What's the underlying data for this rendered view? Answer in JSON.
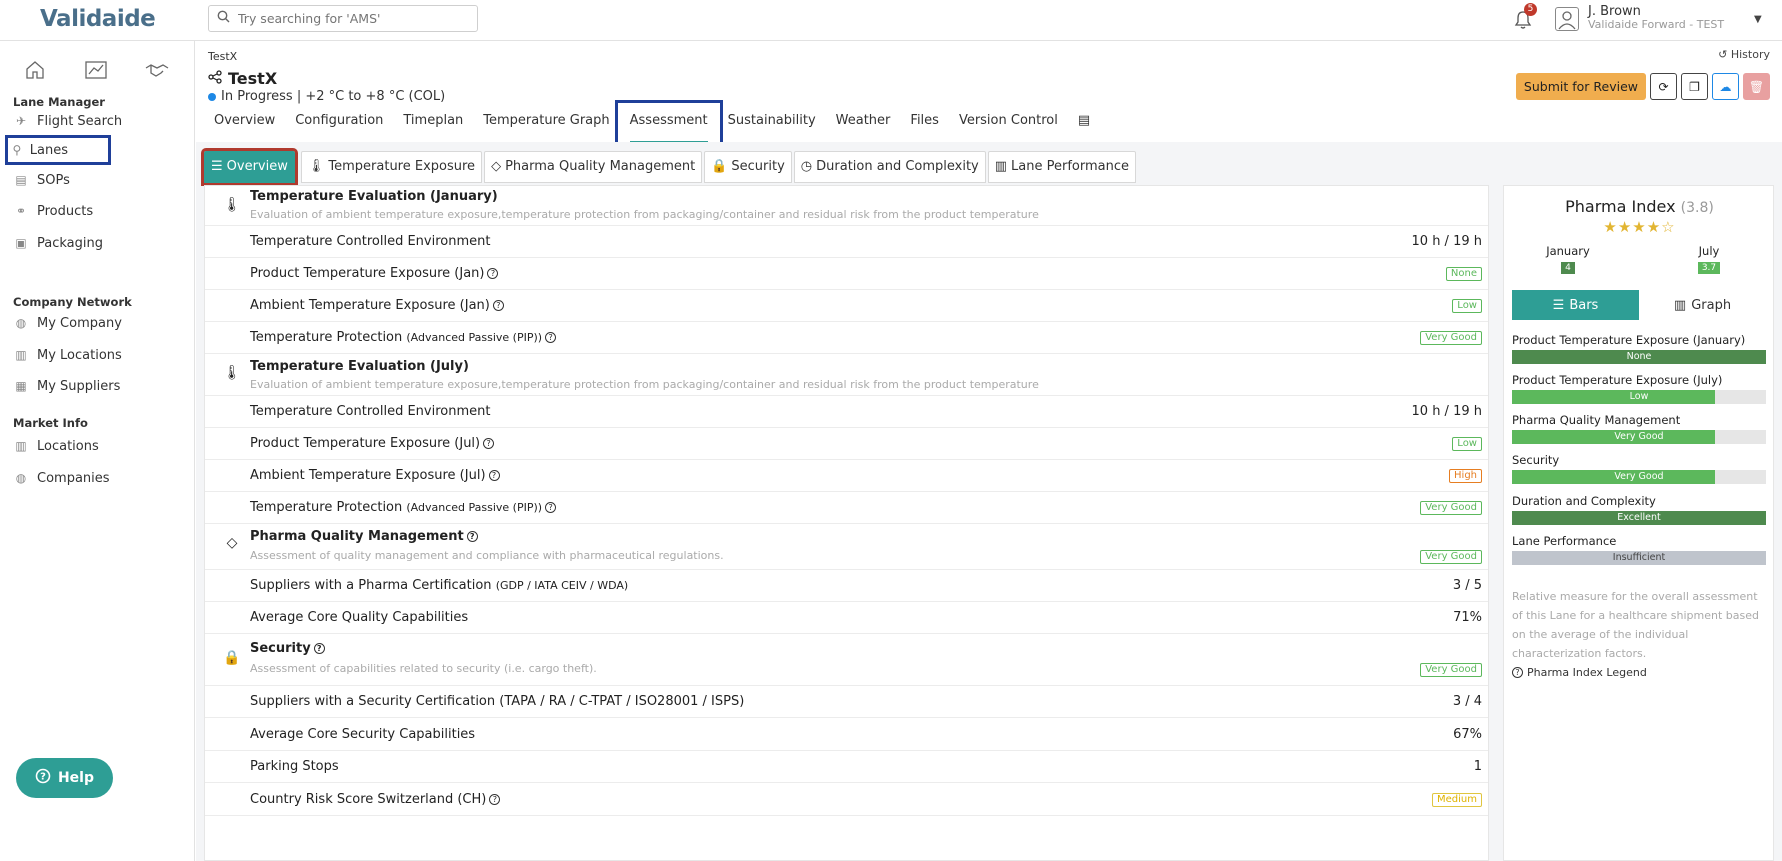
{
  "app": {
    "logo": "Validaide"
  },
  "search": {
    "placeholder": "Try searching for 'AMS'"
  },
  "notifications": {
    "count": "5"
  },
  "user": {
    "name": "J. Brown",
    "org": "Validaide Forward - TEST"
  },
  "sidebar": {
    "sections": [
      {
        "title": "Lane Manager",
        "items": [
          "Flight Search",
          "Lanes",
          "SOPs",
          "Products",
          "Packaging"
        ]
      },
      {
        "title": "Company Network",
        "items": [
          "My Company",
          "My Locations",
          "My Suppliers"
        ]
      },
      {
        "title": "Market Info",
        "items": [
          "Locations",
          "Companies"
        ]
      }
    ],
    "help": "Help"
  },
  "lane": {
    "breadcrumb": "TestX",
    "title": "TestX",
    "status": "In Progress | +2 °C to +8 °C (COL)",
    "history": "History",
    "submit": "Submit for Review"
  },
  "tabs": [
    "Overview",
    "Configuration",
    "Timeplan",
    "Temperature Graph",
    "Assessment",
    "Sustainability",
    "Weather",
    "Files",
    "Version Control"
  ],
  "subtabs": [
    "Overview",
    "Temperature Exposure",
    "Pharma Quality Management",
    "Security",
    "Duration and Complexity",
    "Lane Performance"
  ],
  "rows": {
    "jan_title": "Temperature Evaluation (January)",
    "jan_desc": "Evaluation of ambient temperature exposure,temperature protection from packaging/container and residual risk from the product temperature",
    "jan_tce": "Temperature Controlled Environment",
    "jan_tce_val": "10 h / 19 h",
    "jan_pte": "Product Temperature Exposure (Jan)",
    "jan_pte_val": "None",
    "jan_ate": "Ambient Temperature Exposure (Jan)",
    "jan_ate_val": "Low",
    "jan_tp": "Temperature Protection",
    "jan_tp_small": "(Advanced Passive (PIP))",
    "jan_tp_val": "Very Good",
    "jul_title": "Temperature Evaluation (July)",
    "jul_desc": "Evaluation of ambient temperature exposure,temperature protection from packaging/container and residual risk from the product temperature",
    "jul_tce": "Temperature Controlled Environment",
    "jul_tce_val": "10 h / 19 h",
    "jul_pte": "Product Temperature Exposure (Jul)",
    "jul_pte_val": "Low",
    "jul_ate": "Ambient Temperature Exposure (Jul)",
    "jul_ate_val": "High",
    "jul_tp": "Temperature Protection",
    "jul_tp_small": "(Advanced Passive (PIP))",
    "jul_tp_val": "Very Good",
    "pqm_title": "Pharma Quality Management",
    "pqm_desc": "Assessment of quality management and compliance with pharmaceutical regulations.",
    "pqm_val": "Very Good",
    "pqm_cert": "Suppliers with a Pharma Certification",
    "pqm_cert_small": "(GDP / IATA CEIV / WDA)",
    "pqm_cert_val": "3 / 5",
    "pqm_core": "Average Core Quality Capabilities",
    "pqm_core_val": "71%",
    "sec_title": "Security",
    "sec_desc": "Assessment of capabilities related to security (i.e. cargo theft).",
    "sec_val": "Very Good",
    "sec_cert": "Suppliers with a Security Certification (TAPA / RA / C-TPAT / ISO28001 / ISPS)",
    "sec_cert_val": "3 / 4",
    "sec_core": "Average Core Security Capabilities",
    "sec_core_val": "67%",
    "parking": "Parking Stops",
    "parking_val": "1",
    "country": "Country Risk Score Switzerland (CH)",
    "country_val": "Medium"
  },
  "pharma_index": {
    "title": "Pharma Index",
    "score": "(3.8)",
    "stars": "★★★★☆",
    "months": [
      {
        "name": "January",
        "value": "4"
      },
      {
        "name": "July",
        "value": "3.7"
      }
    ],
    "toggle_bars": "Bars",
    "toggle_graph": "Graph",
    "metrics": [
      {
        "label": "Product Temperature Exposure (January)",
        "text": "None",
        "level": 1.0,
        "color": "#4e8a4e"
      },
      {
        "label": "Product Temperature Exposure (July)",
        "text": "Low",
        "level": 0.8,
        "color": "#5cb85c"
      },
      {
        "label": "Pharma Quality Management",
        "text": "Very Good",
        "level": 0.8,
        "color": "#5cb85c"
      },
      {
        "label": "Security",
        "text": "Very Good",
        "level": 0.8,
        "color": "#5cb85c"
      },
      {
        "label": "Duration and Complexity",
        "text": "Excellent",
        "level": 1.0,
        "color": "#4e8a4e"
      },
      {
        "label": "Lane Performance",
        "text": "Insufficient",
        "level": 1.0,
        "color": "#bfc4cc"
      }
    ],
    "description": "Relative measure for the overall assessment of this Lane for a healthcare shipment based on the average of the individual characterization factors.",
    "legend": "Pharma Index Legend"
  },
  "colors": {
    "accent": "#2e9e95",
    "submit": "#f0ad4e",
    "highlight": "#1f3f99",
    "overview_highlight": "#b03a2e"
  }
}
